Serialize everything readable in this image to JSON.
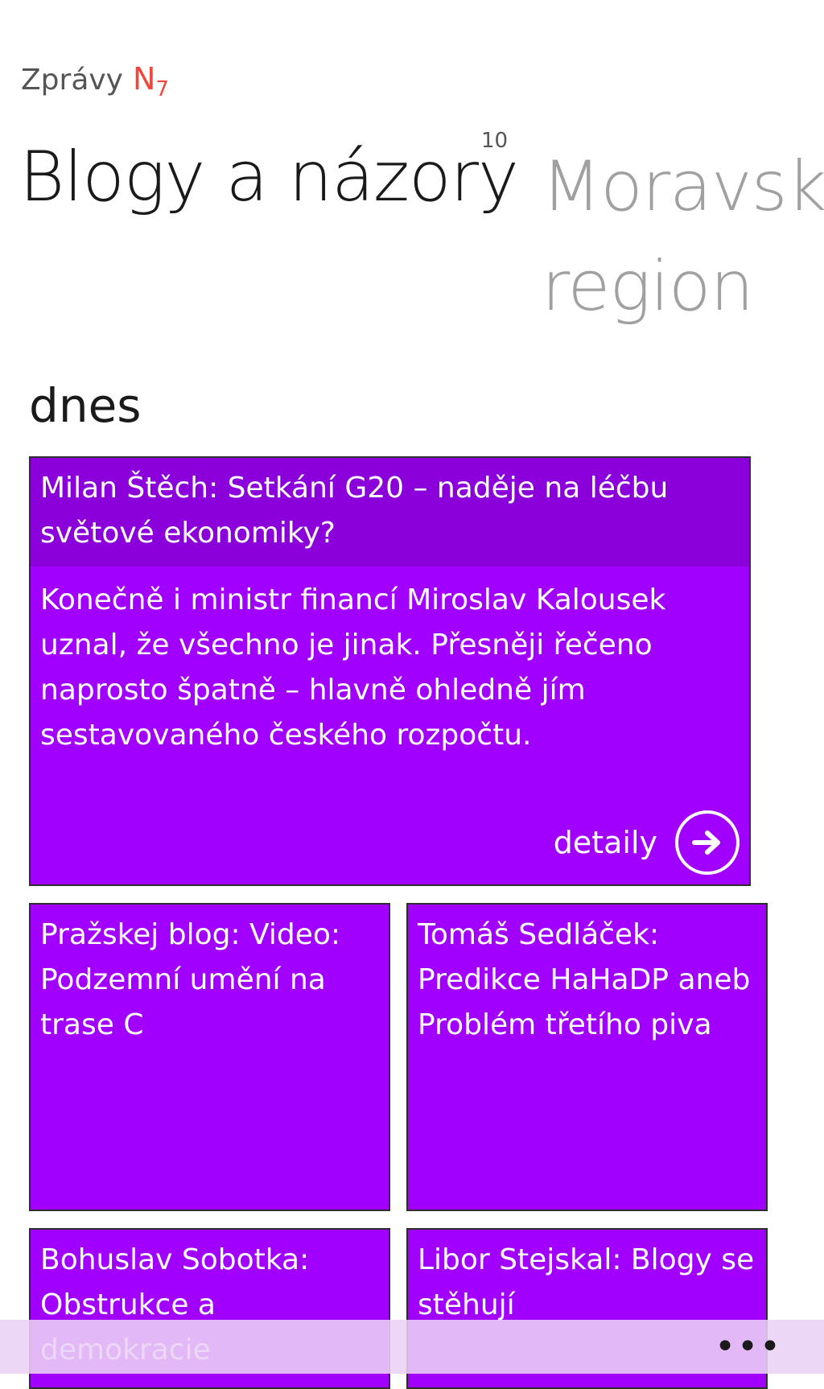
{
  "header": {
    "app_name": "Zprávy",
    "brand_main": "N",
    "brand_sub": "7"
  },
  "pivot": {
    "current_title": "Blogy a názory",
    "current_count": "10",
    "next_title": "Moravsko region"
  },
  "section": {
    "label": "dnes"
  },
  "featured": {
    "title": "Milan Štěch: Setkání G20 – naděje na léčbu světové ekonomiky?",
    "body": "Konečně i ministr financí Miroslav Kalousek uznal, že všechno je jinak. Přesněji řečeno naprosto špatně – hlavně ohledně jím sestavovaného českého rozpočtu.",
    "detail_label": "detaily"
  },
  "articles": [
    {
      "title": "Pražskej blog: Video: Podzemní umění na trase C"
    },
    {
      "title": "Tomáš Sedláček: Predikce HaHaDP aneb Problém třetího piva"
    },
    {
      "title": "Bohuslav Sobotka: Obstrukce a demokracie"
    },
    {
      "title": "Libor Stejskal: Blogy se stěhují"
    }
  ],
  "app_bar": {
    "more_label": "•••"
  },
  "colors": {
    "tile": "#a100ff",
    "tile_header": "#8b00da",
    "brand": "#f2463b"
  }
}
